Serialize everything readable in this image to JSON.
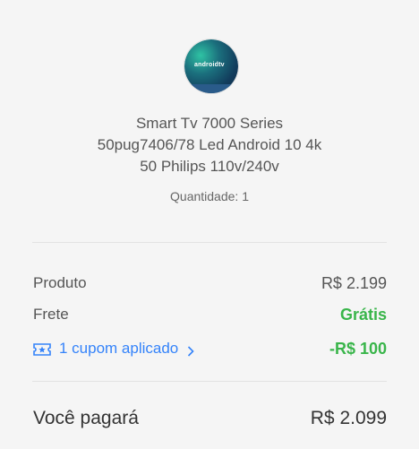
{
  "product": {
    "image_icon": "tv-thumbnail",
    "image_logo_text": "androidtv",
    "title_lines": [
      "Smart Tv 7000 Series",
      "50pug7406/78 Led Android 10 4k",
      "50 Philips 110v/240v"
    ],
    "quantity": "Quantidade: 1"
  },
  "summary": {
    "product_label": "Produto",
    "product_value": "R$ 2.199",
    "shipping_label": "Frete",
    "shipping_value": "Grátis",
    "coupon_label": "1 cupom aplicado",
    "coupon_icon": "ticket-star-icon",
    "coupon_chevron_icon": "chevron-right-icon",
    "discount_value": "-R$ 100"
  },
  "total": {
    "label": "Você pagará",
    "value": "R$ 2.099"
  },
  "colors": {
    "accent_blue": "#3483fa",
    "success_green": "#39b54a",
    "background": "#f5f5f5"
  }
}
